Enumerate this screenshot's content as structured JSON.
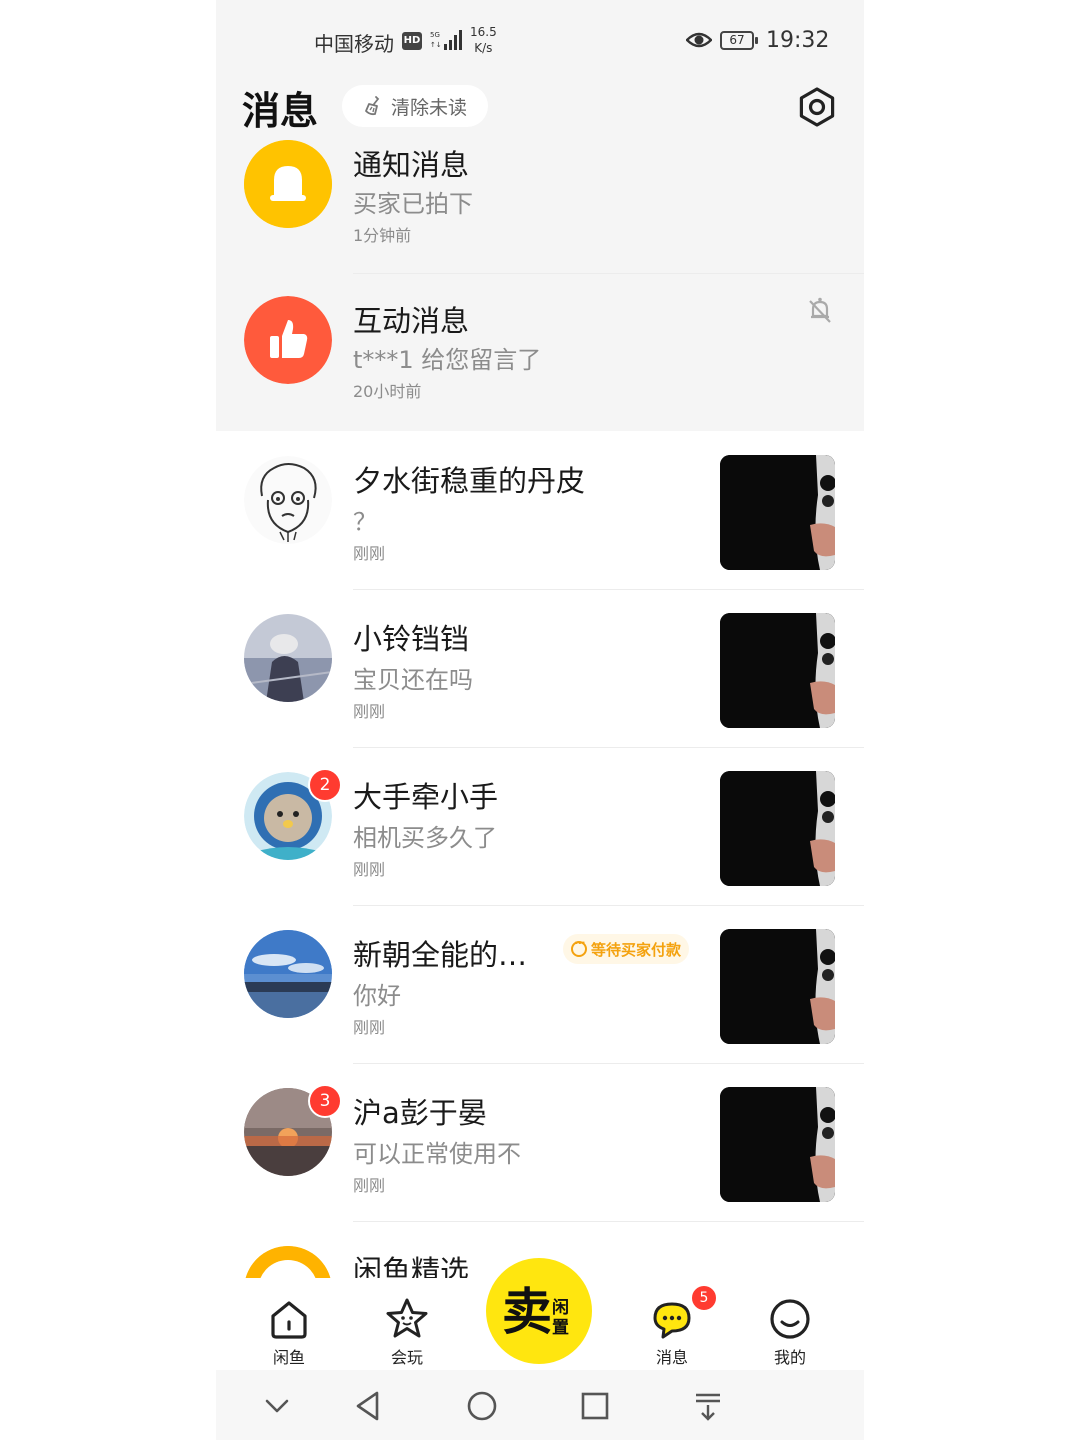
{
  "status_bar": {
    "carrier": "中国移动",
    "hd": "HD",
    "network_speed_value": "16.5",
    "network_speed_unit": "K/s",
    "battery": "67",
    "time": "19:32"
  },
  "header": {
    "title": "消息",
    "clear_unread_label": "清除未读",
    "icons": {
      "clear": "broom-icon",
      "settings": "settings-icon"
    }
  },
  "system_messages": [
    {
      "name": "通知消息",
      "preview": "买家已拍下",
      "time": "1分钟前",
      "icon": "bell-icon",
      "color": "#ffc300"
    },
    {
      "name": "互动消息",
      "preview": "t***1 给您留言了",
      "time": "20小时前",
      "icon": "thumbs-up-icon",
      "color": "#ff5a3c",
      "muted_icon": "bell-off-icon"
    }
  ],
  "conversations": [
    {
      "name": "夕水街稳重的丹皮",
      "preview": "？",
      "time": "刚刚"
    },
    {
      "name": "小铃铛铛",
      "preview": "宝贝还在吗",
      "time": "刚刚"
    },
    {
      "name": "大手牵小手",
      "preview": "相机买多久了",
      "time": "刚刚",
      "unread": "2"
    },
    {
      "name": "新朝全能的…",
      "preview": "你好",
      "time": "刚刚",
      "status": "等待买家付款"
    },
    {
      "name": "沪a彭于晏",
      "preview": "可以正常使用不",
      "time": "刚刚",
      "unread": "3"
    },
    {
      "name": "闲鱼精选"
    }
  ],
  "tab_bar": {
    "tabs": [
      {
        "label": "闲鱼",
        "icon": "home-icon"
      },
      {
        "label": "会玩",
        "icon": "star-face-icon"
      },
      {
        "label": "消息",
        "icon": "chat-bubble-icon",
        "badge": "5"
      },
      {
        "label": "我的",
        "icon": "smile-icon"
      }
    ],
    "sell_button": {
      "main": "卖",
      "sub": "闲置"
    }
  },
  "nav_bar": {
    "icons": [
      "chevron-down-icon",
      "back-triangle-icon",
      "home-circle-icon",
      "recents-square-icon",
      "download-menu-icon"
    ]
  }
}
